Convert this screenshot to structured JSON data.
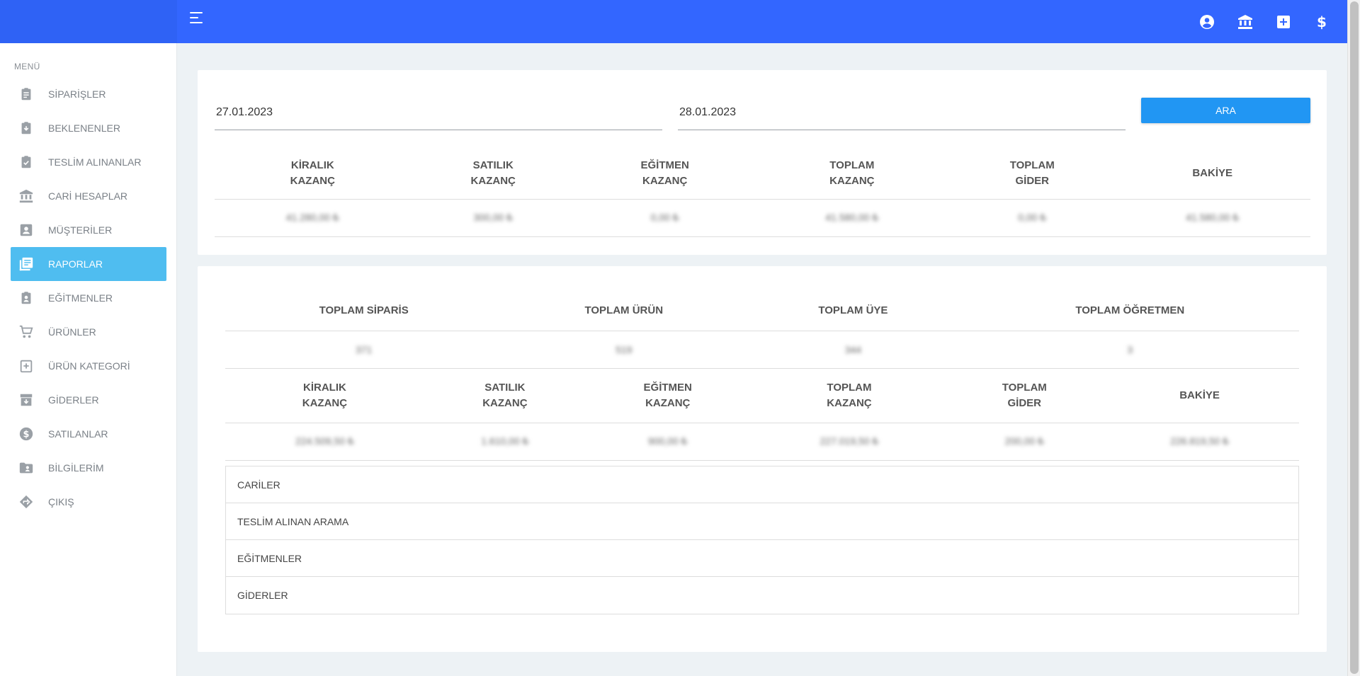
{
  "header": {
    "icons": [
      "menu-icon",
      "account-circle-icon",
      "bank-icon",
      "add-box-icon",
      "dollar-icon"
    ],
    "color": "#3366ff"
  },
  "sidebar": {
    "menu_title": "MENÜ",
    "items": [
      {
        "label": "SİPARİŞLER",
        "icon": "clipboard-icon"
      },
      {
        "label": "BEKLENENLER",
        "icon": "clipboard-arrow-down-icon"
      },
      {
        "label": "TESLİM ALINANLAR",
        "icon": "clipboard-check-icon"
      },
      {
        "label": "CARİ HESAPLAR",
        "icon": "bank-icon"
      },
      {
        "label": "MÜŞTERİLER",
        "icon": "contact-card-icon"
      },
      {
        "label": "RAPORLAR",
        "icon": "library-books-icon"
      },
      {
        "label": "EĞİTMENLER",
        "icon": "clipboard-account-icon"
      },
      {
        "label": "ÜRÜNLER",
        "icon": "cart-icon"
      },
      {
        "label": "ÜRÜN KATEGORİ",
        "icon": "add-category-icon"
      },
      {
        "label": "GİDERLER",
        "icon": "archive-arrow-icon"
      },
      {
        "label": "SATILANLAR",
        "icon": "dollar-circle-icon"
      },
      {
        "label": "BİLGİLERİM",
        "icon": "folder-account-icon"
      },
      {
        "label": "ÇIKIŞ",
        "icon": "exit-sign-icon"
      }
    ],
    "active_index": 5,
    "active_color": "#4fbdf0"
  },
  "filter": {
    "start_date": "27.01.2023",
    "end_date": "28.01.2023",
    "search_label": "ARA",
    "button_color": "#2196f3"
  },
  "summary": {
    "headers": [
      [
        "KİRALIK",
        "KAZANÇ"
      ],
      [
        "SATILIK",
        "KAZANÇ"
      ],
      [
        "EĞİTMEN",
        "KAZANÇ"
      ],
      [
        "TOPLAM",
        "KAZANÇ"
      ],
      [
        "TOPLAM",
        "GİDER"
      ],
      [
        "BAKİYE",
        ""
      ]
    ],
    "values": [
      "41.280,00 ₺",
      "300,00 ₺",
      "0,00 ₺",
      "41.580,00 ₺",
      "0,00 ₺",
      "41.580,00 ₺"
    ]
  },
  "totals": {
    "headers": [
      "TOPLAM SİPARİS",
      "TOPLAM ÜRÜN",
      "TOPLAM ÜYE",
      "TOPLAM ÖĞRETMEN"
    ],
    "values": [
      "371",
      "519",
      "344",
      "3"
    ]
  },
  "overall": {
    "headers": [
      [
        "KİRALIK",
        "KAZANÇ"
      ],
      [
        "SATILIK",
        "KAZANÇ"
      ],
      [
        "EĞİTMEN",
        "KAZANÇ"
      ],
      [
        "TOPLAM",
        "KAZANÇ"
      ],
      [
        "TOPLAM",
        "GİDER"
      ],
      [
        "BAKİYE",
        ""
      ]
    ],
    "values": [
      "224.509,50 ₺",
      "1.610,00 ₺",
      "900,00 ₺",
      "227.019,50 ₺",
      "200,00 ₺",
      "226.819,50 ₺"
    ]
  },
  "accordion": [
    "CARİLER",
    "TESLİM ALINAN ARAMA",
    "EĞİTMENLER",
    "GİDERLER"
  ]
}
